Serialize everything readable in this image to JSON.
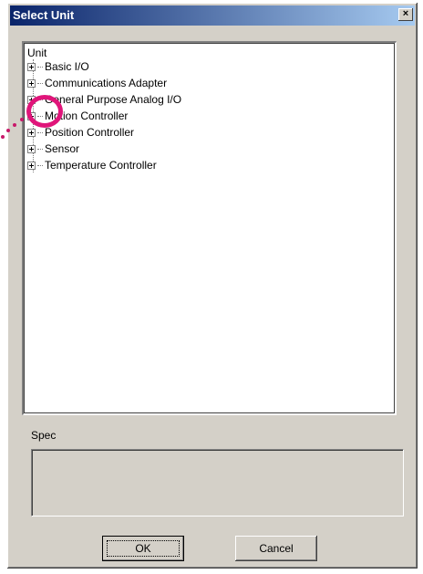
{
  "window": {
    "title": "Select Unit",
    "close_label": "×"
  },
  "tree": {
    "root_label": "Unit",
    "items": [
      {
        "label": "Basic I/O"
      },
      {
        "label": "Communications Adapter"
      },
      {
        "label": "General Purpose Analog I/O"
      },
      {
        "label": "Motion Controller"
      },
      {
        "label": "Position Controller"
      },
      {
        "label": "Sensor"
      },
      {
        "label": "Temperature Controller"
      }
    ]
  },
  "spec": {
    "label": "Spec",
    "value": ""
  },
  "buttons": {
    "ok": "OK",
    "cancel": "Cancel"
  },
  "annotation": {
    "highlight_color": "#e0157a"
  }
}
